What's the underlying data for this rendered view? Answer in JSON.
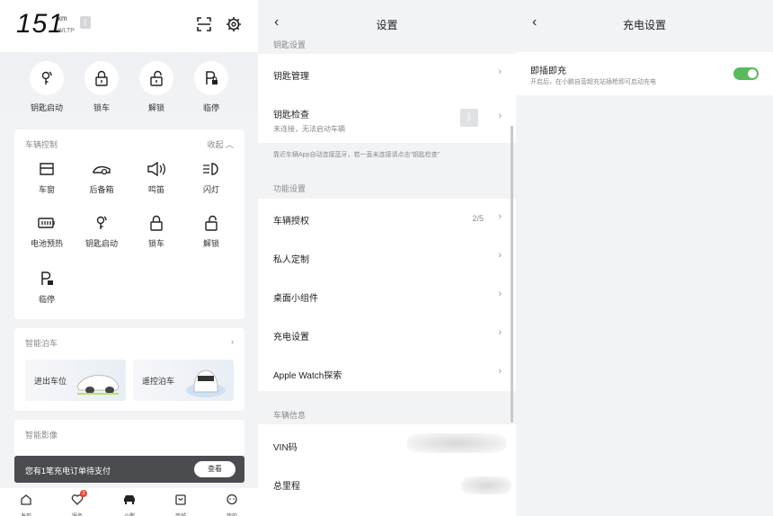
{
  "home": {
    "range_value": "151",
    "range_unit": "km",
    "range_standard": "WLTP",
    "bt_icon": "bluetooth-icon",
    "quick_actions": [
      {
        "label": "钥匙启动",
        "icon": "key-start-icon"
      },
      {
        "label": "锁车",
        "icon": "lock-icon"
      },
      {
        "label": "解锁",
        "icon": "unlock-icon"
      },
      {
        "label": "临停",
        "icon": "parking-lock-icon"
      }
    ],
    "vehicle_control": {
      "title": "车辆控制",
      "collapse_label": "收起",
      "items": [
        {
          "label": "车窗",
          "icon": "window-icon"
        },
        {
          "label": "后备箱",
          "icon": "trunk-icon"
        },
        {
          "label": "鸣笛",
          "icon": "horn-icon"
        },
        {
          "label": "闪灯",
          "icon": "headlight-icon"
        },
        {
          "label": "电池预热",
          "icon": "battery-heat-icon"
        },
        {
          "label": "钥匙启动",
          "icon": "key-start-icon"
        },
        {
          "label": "锁车",
          "icon": "lock-icon"
        },
        {
          "label": "解锁",
          "icon": "unlock-icon"
        },
        {
          "label": "临停",
          "icon": "parking-lock-icon"
        }
      ]
    },
    "smart_parking": {
      "title": "智能泊车",
      "tiles": [
        {
          "label": "进出车位"
        },
        {
          "label": "遥控泊车"
        }
      ]
    },
    "smart_imaging": {
      "title": "智能影像"
    },
    "toast": {
      "text": "您有1笔充电订单待支付",
      "button": "查看"
    },
    "tabs": [
      {
        "label": "发现",
        "icon": "home-icon"
      },
      {
        "label": "服务",
        "icon": "heart-icon",
        "badge": "3"
      },
      {
        "label": "小鹏",
        "icon": "car-icon"
      },
      {
        "label": "商城",
        "icon": "shop-icon"
      },
      {
        "label": "我的",
        "icon": "profile-icon"
      }
    ]
  },
  "settings": {
    "title": "设置",
    "key_section": "钥匙设置",
    "key_manage": "钥匙管理",
    "key_check": "钥匙检查",
    "key_check_sub": "未连接，无法启动车辆",
    "key_hint": "靠近车辆App自动连接蓝牙，若一直未连接请点击“钥匙检查”",
    "func_section": "功能设置",
    "func_items": [
      {
        "label": "车辆授权",
        "value": "2/5"
      },
      {
        "label": "私人定制",
        "value": ""
      },
      {
        "label": "桌面小组件",
        "value": ""
      },
      {
        "label": "充电设置",
        "value": ""
      },
      {
        "label": "Apple Watch探索",
        "value": ""
      }
    ],
    "info_section": "车辆信息",
    "info_items": [
      {
        "label": "VIN码"
      },
      {
        "label": "总里程"
      }
    ]
  },
  "charge": {
    "title": "充电设置",
    "plug_charge_label": "即插即充",
    "plug_charge_desc": "开启后，在小鹏自营超充站插枪即可启动充电",
    "plug_charge_on": true,
    "accent": "#5cb85c"
  }
}
